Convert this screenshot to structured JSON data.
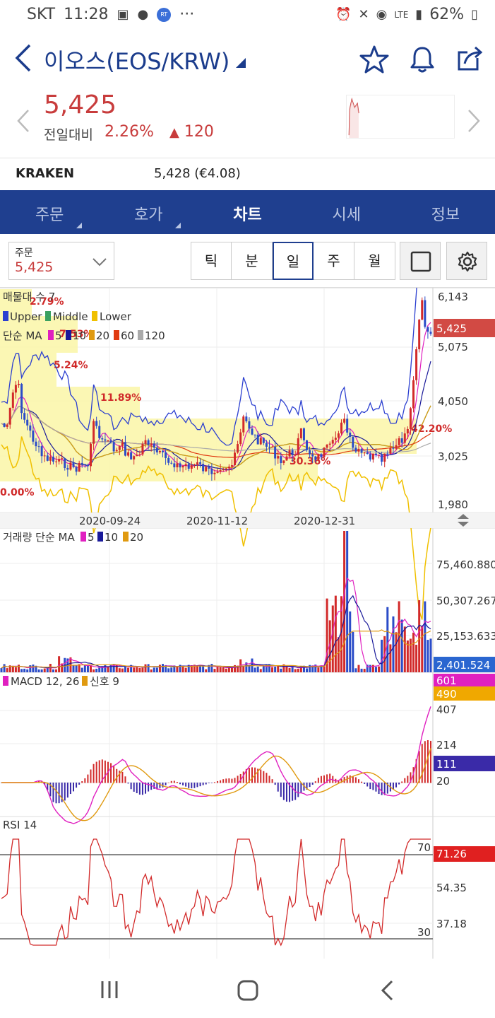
{
  "status_bar": {
    "carrier": "SKT",
    "time": "11:28",
    "badge_text": "RT",
    "more": "···",
    "network": "LTE",
    "battery": "62%"
  },
  "header": {
    "title": "이오스(EOS/KRW)"
  },
  "price": {
    "current": "5,425",
    "diff_label": "전일대비",
    "diff_pct": "2.26%",
    "diff_abs": "120"
  },
  "exchange": {
    "name": "KRAKEN",
    "value": "5,428 (€4.08)"
  },
  "tabs": [
    {
      "label": "주문"
    },
    {
      "label": "호가"
    },
    {
      "label": "차트"
    },
    {
      "label": "시세"
    },
    {
      "label": "정보"
    }
  ],
  "order": {
    "label": "주문",
    "value": "5,425"
  },
  "period_buttons": [
    "틱",
    "분",
    "일",
    "주",
    "월"
  ],
  "colors": {
    "accent": "#1f3f8f",
    "up": "#c83c3c",
    "down": "#2b4cc8"
  },
  "chart_data": [
    {
      "type": "candlestick",
      "legend_1": "매물대 수 7",
      "legend_2": [
        "Upper",
        "Middle",
        "Lower"
      ],
      "legend_3_prefix": "단순 MA",
      "legend_3": [
        "5",
        "10",
        "20",
        "60",
        "120"
      ],
      "y_ticks": [
        "6,143",
        "5,075",
        "4,050",
        "3,025",
        "1,980"
      ],
      "last_value": "5,425",
      "x_ticks": [
        "2020-09-24",
        "2020-11-12",
        "2020-12-31"
      ],
      "volume_profile_labels": [
        "2.79%",
        "7.53%",
        "5.24%",
        "11.89%",
        "42.20%",
        "30.36%",
        "0.00%"
      ]
    },
    {
      "type": "bar",
      "legend_prefix": "거래량 단순 MA",
      "legend": [
        "5",
        "10",
        "20"
      ],
      "y_ticks": [
        "75,460.880",
        "50,307.267",
        "25,153.633"
      ],
      "last_value": "2,401.524"
    },
    {
      "type": "line",
      "legend": [
        "MACD 12, 26",
        "신호 9"
      ],
      "y_ticks": [
        "407",
        "214",
        "20"
      ],
      "badges": [
        "601",
        "490",
        "111"
      ]
    },
    {
      "type": "line",
      "legend": "RSI 14",
      "y_ticks": [
        "54.35",
        "37.18"
      ],
      "levels": [
        "70",
        "30"
      ],
      "last_value": "71.26"
    }
  ]
}
